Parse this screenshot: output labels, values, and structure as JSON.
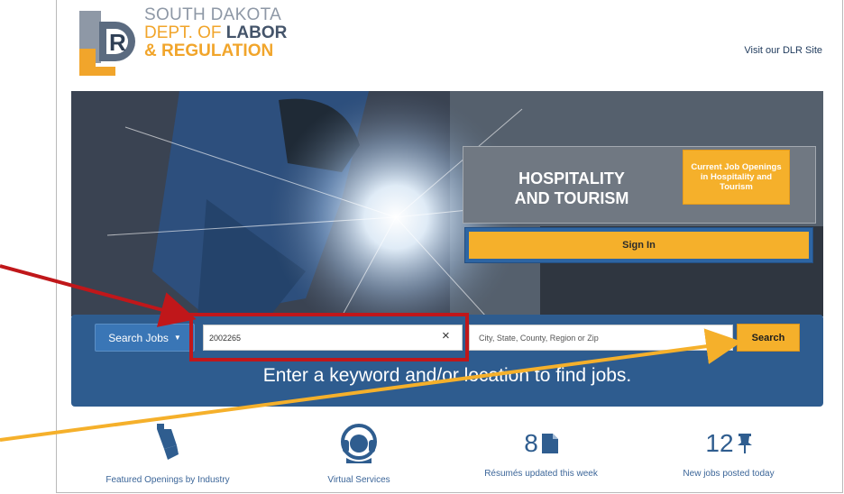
{
  "header": {
    "logo_line1": "SOUTH DAKOTA",
    "logo_line2a": "DEPT. OF ",
    "logo_line2b": "LABOR",
    "logo_line3": "& REGULATION",
    "visit_link": "Visit our DLR Site"
  },
  "hero": {
    "panel_title_line1": "HOSPITALITY",
    "panel_title_line2": "AND TOURISM",
    "badge": "Current Job Openings in Hospitality and Tourism",
    "signin": "Sign In"
  },
  "search": {
    "type_label": "Search Jobs",
    "keyword_value": "2002265",
    "clear_icon": "×",
    "location_placeholder": "City, State, County, Region or Zip",
    "button": "Search",
    "tagline": "Enter a keyword and/or location to find jobs."
  },
  "features": [
    {
      "label": "Featured Openings by Industry",
      "icon": "spotlight-icon"
    },
    {
      "label": "Virtual Services",
      "icon": "headset-icon"
    },
    {
      "count": "8",
      "label": "Résumés updated this week",
      "icon": "document-icon"
    },
    {
      "count": "12",
      "label": "New jobs posted today",
      "icon": "pin-icon"
    }
  ],
  "colors": {
    "accent": "#f5b02b",
    "brand_blue": "#2e5c8f",
    "annotation_red": "#c0171a"
  }
}
